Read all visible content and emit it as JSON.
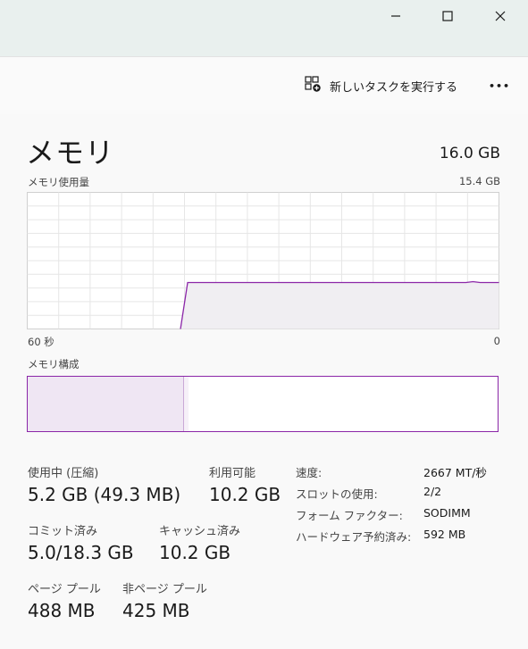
{
  "window": {
    "minimize_symbol": "—",
    "maximize_symbol": "☐",
    "close_symbol": "✕"
  },
  "toolbar": {
    "new_task_label": "新しいタスクを実行する",
    "more_label": "•••"
  },
  "memory": {
    "title": "メモリ",
    "total": "16.0 GB",
    "usage_label": "メモリ使用量",
    "usage_max": "15.4 GB",
    "axis_left": "60 秒",
    "axis_right": "0",
    "composition_label": "メモリ構成"
  },
  "usage_graph": {
    "line_color": "#8b26a8",
    "fill_color": "#f0eef2",
    "grid_color": "#e6e6e6",
    "level_percent": 34,
    "start_fraction": 0.34
  },
  "composition": {
    "in_use_fraction": 0.33,
    "modified_fraction": 0.01,
    "in_use_color": "#efe6f3",
    "border_color": "#8b26a8"
  },
  "stats": {
    "in_use_label": "使用中 (圧縮)",
    "in_use_value": "5.2 GB (49.3 MB)",
    "available_label": "利用可能",
    "available_value": "10.2 GB",
    "committed_label": "コミット済み",
    "committed_value": "5.0/18.3 GB",
    "cached_label": "キャッシュ済み",
    "cached_value": "10.2 GB",
    "paged_pool_label": "ページ プール",
    "paged_pool_value": "488 MB",
    "nonpaged_pool_label": "非ページ プール",
    "nonpaged_pool_value": "425 MB"
  },
  "specs": {
    "speed_label": "速度:",
    "speed_value": "2667 MT/秒",
    "slots_label": "スロットの使用:",
    "slots_value": "2/2",
    "form_factor_label": "フォーム ファクター:",
    "form_factor_value": "SODIMM",
    "reserved_label": "ハードウェア予約済み:",
    "reserved_value": "592 MB"
  }
}
